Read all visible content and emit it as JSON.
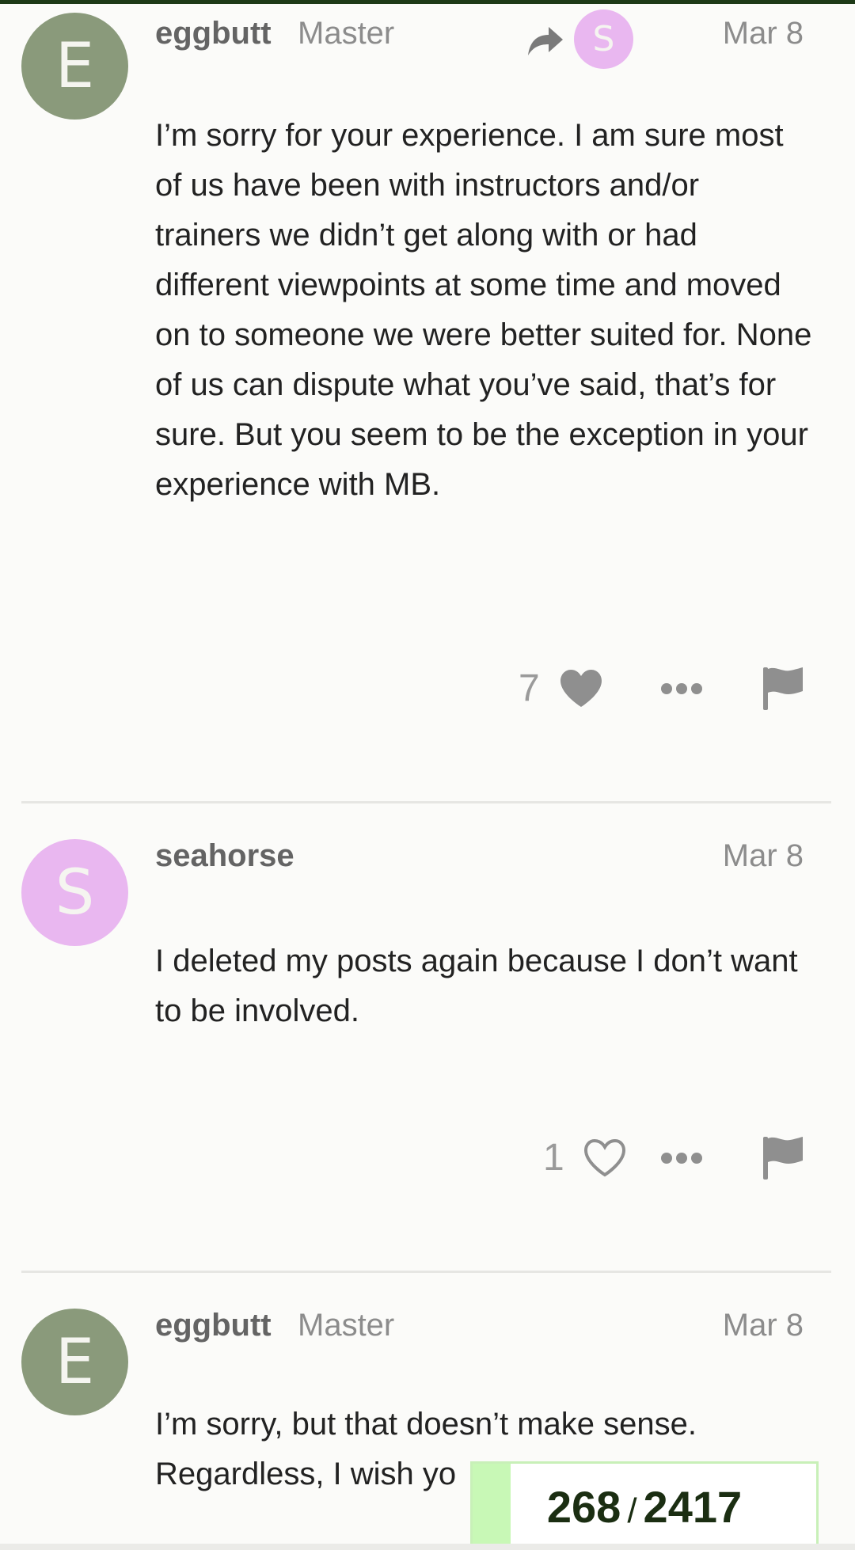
{
  "posts": [
    {
      "avatar_letter": "E",
      "username": "eggbutt",
      "user_title": "Master",
      "reply_to_avatar_letter": "S",
      "date": "Mar 8",
      "body": "I’m sorry for your experience. I am sure most of us have been with instructors and/or trainers we didn’t get along with or had different viewpoints at some time and moved on to someone we were better suited for. None of us can dispute what you’ve said, that’s for sure. But you seem to be the exception in your experience with MB.",
      "like_count": "7",
      "liked": true
    },
    {
      "avatar_letter": "S",
      "username": "seahorse",
      "date": "Mar 8",
      "body": "I deleted my posts again because I don’t want to be involved.",
      "like_count": "1",
      "liked": false
    },
    {
      "avatar_letter": "E",
      "username": "eggbutt",
      "user_title": "Master",
      "date": "Mar 8",
      "body": "I’m sorry, but that doesn’t make sense. Regardless, I wish yo"
    }
  ],
  "progress": {
    "current": "268",
    "total": "2417",
    "separator": "/",
    "fraction": 0.111
  },
  "colors": {
    "avatar_e": "#8a9a7b",
    "avatar_s": "#e9b7f0",
    "progress_fill": "#c8f8b6",
    "accent_dark": "#1e3a17"
  },
  "icons": [
    "reply-arrow-icon",
    "heart-filled-icon",
    "heart-outline-icon",
    "more-dots-icon",
    "flag-icon"
  ]
}
